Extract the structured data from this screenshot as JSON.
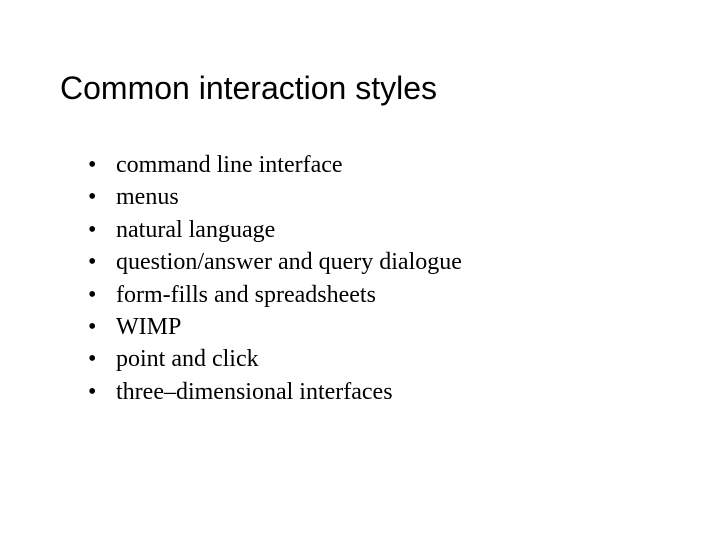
{
  "title": "Common interaction styles",
  "bullets": [
    "command line interface",
    "menus",
    "natural language",
    "question/answer and query dialogue",
    "form-fills and spreadsheets",
    "WIMP",
    "point and click",
    "three–dimensional interfaces"
  ]
}
